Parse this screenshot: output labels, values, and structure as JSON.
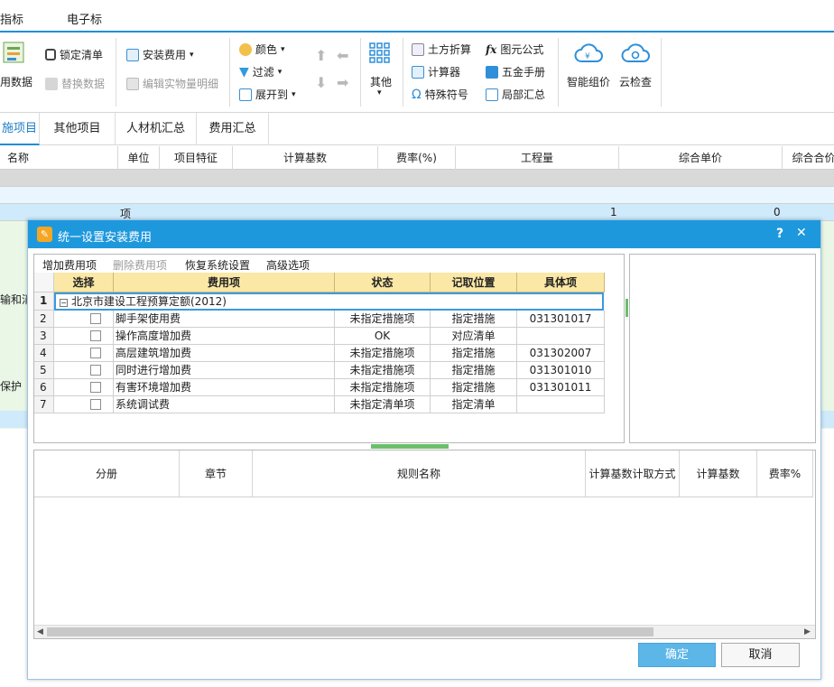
{
  "menu": {
    "item1": "指标",
    "item2": "电子标"
  },
  "ribbon": {
    "use_data": "用数据",
    "lock_list": "锁定清单",
    "replace_data": "替换数据",
    "install_fee": "安装费用",
    "edit_detail": "编辑实物量明细",
    "color": "颜色",
    "filter": "过滤",
    "expand_to": "展开到",
    "other": "其他",
    "earthwork": "土方折算",
    "calculator": "计算器",
    "special_symbol": "特殊符号",
    "formula": "图元公式",
    "hardware_manual": "五金手册",
    "local_summary": "局部汇总",
    "smart_pricing": "智能组价",
    "cloud_check": "云检查"
  },
  "tabs": [
    "施项目",
    "其他项目",
    "人材机汇总",
    "费用汇总"
  ],
  "grid": {
    "headers": [
      "名称",
      "单位",
      "项目特征",
      "计算基数",
      "费率(%)",
      "工程量",
      "综合单价",
      "综合合价"
    ],
    "row3": {
      "unit": "项",
      "qty": "1",
      "price": "0"
    },
    "left_text1": "输和消",
    "left_text2": "保护"
  },
  "dialog": {
    "title": "统一设置安装费用",
    "help": "?",
    "close": "✕",
    "toolbar": {
      "add": "增加费用项",
      "delete": "删除费用项",
      "restore": "恢复系统设置",
      "advanced": "高级选项"
    },
    "fee_headers": [
      "选择",
      "费用项",
      "状态",
      "记取位置",
      "具体项"
    ],
    "group_label": "北京市建设工程预算定额(2012)",
    "rows": [
      {
        "num": "2",
        "name": "脚手架使用费",
        "status": "未指定措施项",
        "position": "指定措施",
        "item": "031301017"
      },
      {
        "num": "3",
        "name": "操作高度增加费",
        "status": "OK",
        "position": "对应清单",
        "item": ""
      },
      {
        "num": "4",
        "name": "高层建筑增加费",
        "status": "未指定措施项",
        "position": "指定措施",
        "item": "031302007"
      },
      {
        "num": "5",
        "name": "同时进行增加费",
        "status": "未指定措施项",
        "position": "指定措施",
        "item": "031301010"
      },
      {
        "num": "6",
        "name": "有害环境增加费",
        "status": "未指定措施项",
        "position": "指定措施",
        "item": "031301011"
      },
      {
        "num": "7",
        "name": "系统调试费",
        "status": "未指定清单项",
        "position": "指定清单",
        "item": ""
      }
    ],
    "row1_num": "1",
    "rule_headers": [
      "分册",
      "章节",
      "规则名称",
      "计算基数计取方式",
      "计算基数",
      "费率%"
    ],
    "ok": "确定",
    "cancel": "取消"
  },
  "colors": {
    "accent": "#1e98dc",
    "header_yellow": "#fbe8a6",
    "row_blue": "#cfeafb"
  }
}
